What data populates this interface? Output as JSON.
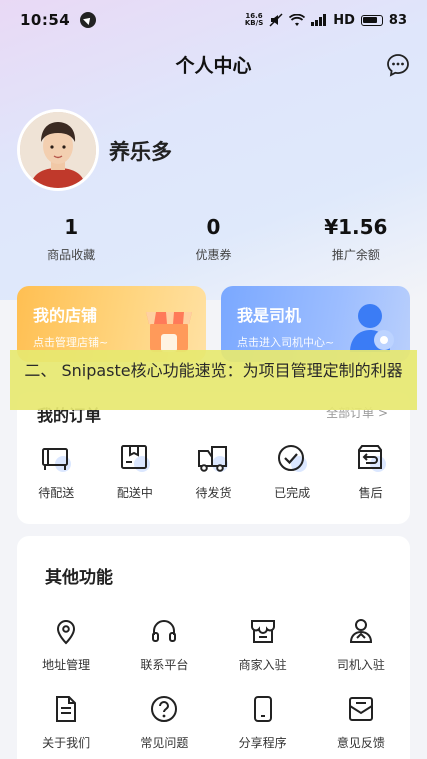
{
  "status_bar": {
    "time": "10:54",
    "net_speed_top": "16.6",
    "net_speed_bottom": "KB/S",
    "network": "HD",
    "battery": "83"
  },
  "header": {
    "title": "个人中心"
  },
  "profile": {
    "name": "养乐多"
  },
  "stats": [
    {
      "value": "1",
      "label": "商品收藏"
    },
    {
      "value": "0",
      "label": "优惠券"
    },
    {
      "value": "¥1.56",
      "label": "推广余额"
    }
  ],
  "cards": {
    "store": {
      "title": "我的店铺",
      "subtitle": "点击管理店铺~"
    },
    "driver": {
      "title": "我是司机",
      "subtitle": "点击进入司机中心~"
    }
  },
  "orders": {
    "title": "我的订单",
    "all_label": "全部订单 >",
    "items": [
      {
        "label": "待配送",
        "icon": "screen-box-icon"
      },
      {
        "label": "配送中",
        "icon": "package-icon"
      },
      {
        "label": "待发货",
        "icon": "truck-icon"
      },
      {
        "label": "已完成",
        "icon": "check-circle-icon"
      },
      {
        "label": "售后",
        "icon": "return-box-icon"
      }
    ]
  },
  "other": {
    "title": "其他功能",
    "items": [
      {
        "label": "地址管理",
        "icon": "location-pin-icon"
      },
      {
        "label": "联系平台",
        "icon": "headphones-icon"
      },
      {
        "label": "商家入驻",
        "icon": "store-icon"
      },
      {
        "label": "司机入驻",
        "icon": "user-card-icon"
      },
      {
        "label": "关于我们",
        "icon": "document-icon"
      },
      {
        "label": "常见问题",
        "icon": "question-circle-icon"
      },
      {
        "label": "分享程序",
        "icon": "phone-icon"
      },
      {
        "label": "意见反馈",
        "icon": "feedback-icon"
      }
    ]
  },
  "overlay_banner": {
    "text": "二、 Snipaste核心功能速览：为项目管理定制的利器"
  },
  "colors": {
    "accent_orange": "#ffbf52",
    "accent_blue": "#7aa8ff",
    "banner": "#e7e870"
  }
}
